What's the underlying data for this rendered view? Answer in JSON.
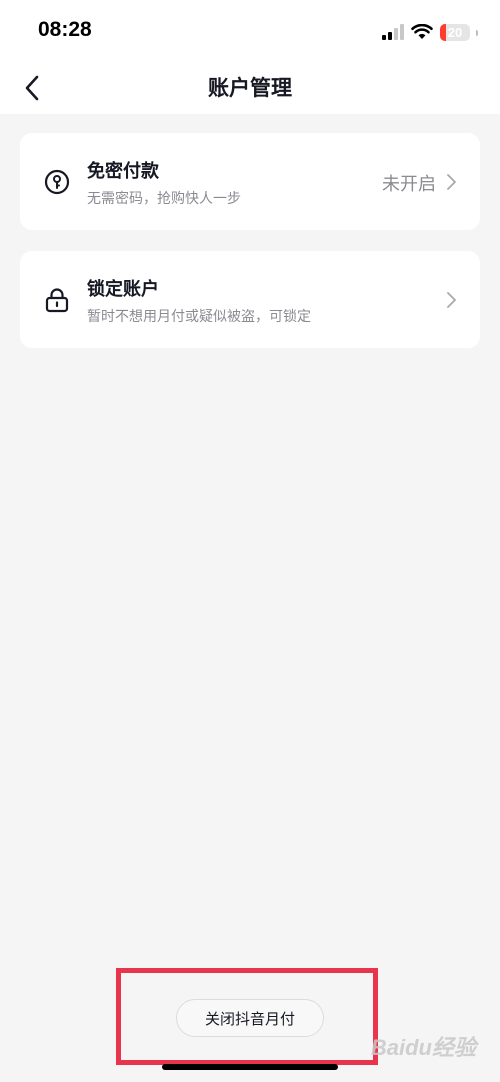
{
  "status_bar": {
    "time": "08:28",
    "battery_level": "20",
    "battery_fraction": 0.2,
    "battery_color": "#ff3b30"
  },
  "nav": {
    "title": "账户管理",
    "back_icon": "chevron-left-icon"
  },
  "settings": [
    {
      "icon": "key-icon",
      "title": "免密付款",
      "subtitle": "无需密码，抢购快人一步",
      "value": "未开启"
    },
    {
      "icon": "lock-icon",
      "title": "锁定账户",
      "subtitle": "暂时不想用月付或疑似被盗，可锁定",
      "value": ""
    }
  ],
  "footer": {
    "close_button_label": "关闭抖音月付"
  },
  "colors": {
    "highlight": "#e8344c",
    "background": "#f5f5f5",
    "secondary_text": "#8a8b91"
  },
  "watermark": "Baidu经验"
}
